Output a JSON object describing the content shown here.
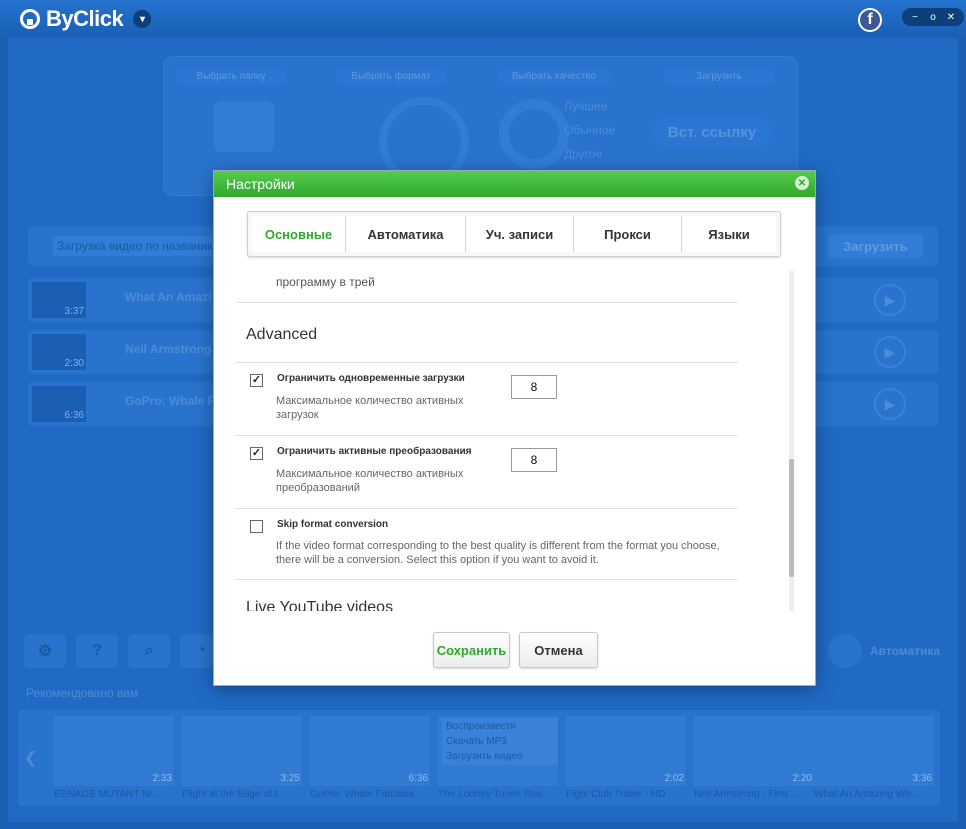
{
  "app": {
    "brand": "ByClick",
    "menu_glyph": "▾",
    "fb_glyph": "f",
    "win": {
      "min": "−",
      "restore": "o",
      "close": "✕"
    }
  },
  "steps": {
    "folder": "Выбрать папку",
    "format": "Выбрать формат",
    "quality": "Выбрать качество",
    "download": "Загрузить",
    "quality_options": [
      "Лучшее",
      "Обычное",
      "Другое"
    ],
    "paste_button": "Вст. ссылку"
  },
  "search": {
    "placeholder": "Загрузка видео по названию",
    "button": "Загрузить"
  },
  "videos": [
    {
      "title": "What An Amazi",
      "duration": "3:37"
    },
    {
      "title": "Neil Armstrong",
      "duration": "2:30"
    },
    {
      "title": "GoPro: Whale F",
      "duration": "6:36"
    }
  ],
  "toolbar": {
    "auto_label": "Автоматика"
  },
  "recommended": {
    "label": "Рекомендовано вам",
    "items": [
      {
        "title": "EENAGE MUTANT NI...",
        "duration": "2:33"
      },
      {
        "title": "Flight at the Edge of t...",
        "duration": "3:25"
      },
      {
        "title": "GoPro: Whale Fantasia",
        "duration": "6:36"
      },
      {
        "title": "The Looney Tunes Sho...",
        "duration": ""
      },
      {
        "title": "Fight Club Trailer - HD",
        "duration": "2:02"
      },
      {
        "title": "Neil Armstrong - First ...",
        "duration": "2:20"
      },
      {
        "title": "What An Amazing Wo...",
        "duration": "3:36"
      }
    ],
    "context_menu": [
      "Воспроизвести",
      "Скачать MP3",
      "Загрузить видео"
    ]
  },
  "dialog": {
    "title": "Настройки",
    "tabs": [
      "Основные",
      "Автоматика",
      "Уч. записи",
      "Прокси",
      "Языки"
    ],
    "active_tab": "Основные",
    "prev_text": "программу в трей",
    "section_title": "Advanced",
    "options": [
      {
        "title": "Ограничить одновременные загрузки",
        "description": "Максимальное количество активных загрузок",
        "checked": true,
        "value": "8"
      },
      {
        "title": "Ограничить активные преобразования",
        "description": "Максимальное количество активных преобразований",
        "checked": true,
        "value": "8"
      },
      {
        "title": "Skip format conversion",
        "description": "If the video format corresponding to the best quality is different from the format you choose, there will be a conversion. Select this option if you want to avoid it.",
        "checked": false
      }
    ],
    "next_section": "Live YouTube videos",
    "save_button": "Сохранить",
    "cancel_button": "Отмена"
  }
}
